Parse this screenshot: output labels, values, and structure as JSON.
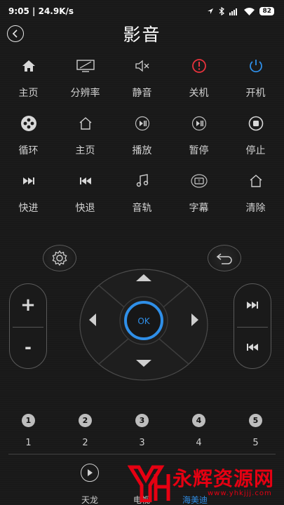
{
  "status_bar": {
    "time": "9:05",
    "speed": "24.9K/s",
    "battery": "82",
    "icons": [
      "location-icon",
      "bluetooth-icon",
      "signal-icon",
      "wifi-icon",
      "battery-icon"
    ]
  },
  "header": {
    "title": "影音",
    "back_icon": "chevron-left-icon"
  },
  "function_rows": [
    [
      {
        "label": "主页",
        "icon": "home-filled-icon"
      },
      {
        "label": "分辨率",
        "icon": "screen-resolution-icon"
      },
      {
        "label": "静音",
        "icon": "mute-icon"
      },
      {
        "label": "关机",
        "icon": "power-off-icon",
        "color": "#e8323c"
      },
      {
        "label": "开机",
        "icon": "power-on-icon",
        "color": "#2f8fe8"
      }
    ],
    [
      {
        "label": "循环",
        "icon": "loop-icon"
      },
      {
        "label": "主页",
        "icon": "home-outline-icon"
      },
      {
        "label": "播放",
        "icon": "play-pause-icon"
      },
      {
        "label": "暂停",
        "icon": "pause-icon"
      },
      {
        "label": "停止",
        "icon": "stop-icon"
      }
    ],
    [
      {
        "label": "快进",
        "icon": "fast-forward-icon"
      },
      {
        "label": "快退",
        "icon": "rewind-icon"
      },
      {
        "label": "音轨",
        "icon": "music-note-icon"
      },
      {
        "label": "字幕",
        "icon": "subtitle-icon"
      },
      {
        "label": "清除",
        "icon": "home-outline-icon"
      }
    ]
  ],
  "controls": {
    "settings_icon": "gear-icon",
    "return_icon": "return-icon",
    "volume_up": "+",
    "volume_down": "-",
    "ok_label": "OK",
    "next_icon": "skip-next-icon",
    "prev_icon": "skip-previous-icon",
    "accent": "#2f8fe8"
  },
  "number_buttons": [
    "1",
    "2",
    "3",
    "4",
    "5"
  ],
  "number_labels": [
    "1",
    "2",
    "3",
    "4",
    "5"
  ],
  "bottom_bar": {
    "labels": [
      "天龙",
      "电视",
      "海美迪"
    ],
    "play_icon": "play-icon"
  },
  "watermark": {
    "text": "永辉资源网",
    "url": "www.yhkjjj.com",
    "color": "#e60012"
  }
}
